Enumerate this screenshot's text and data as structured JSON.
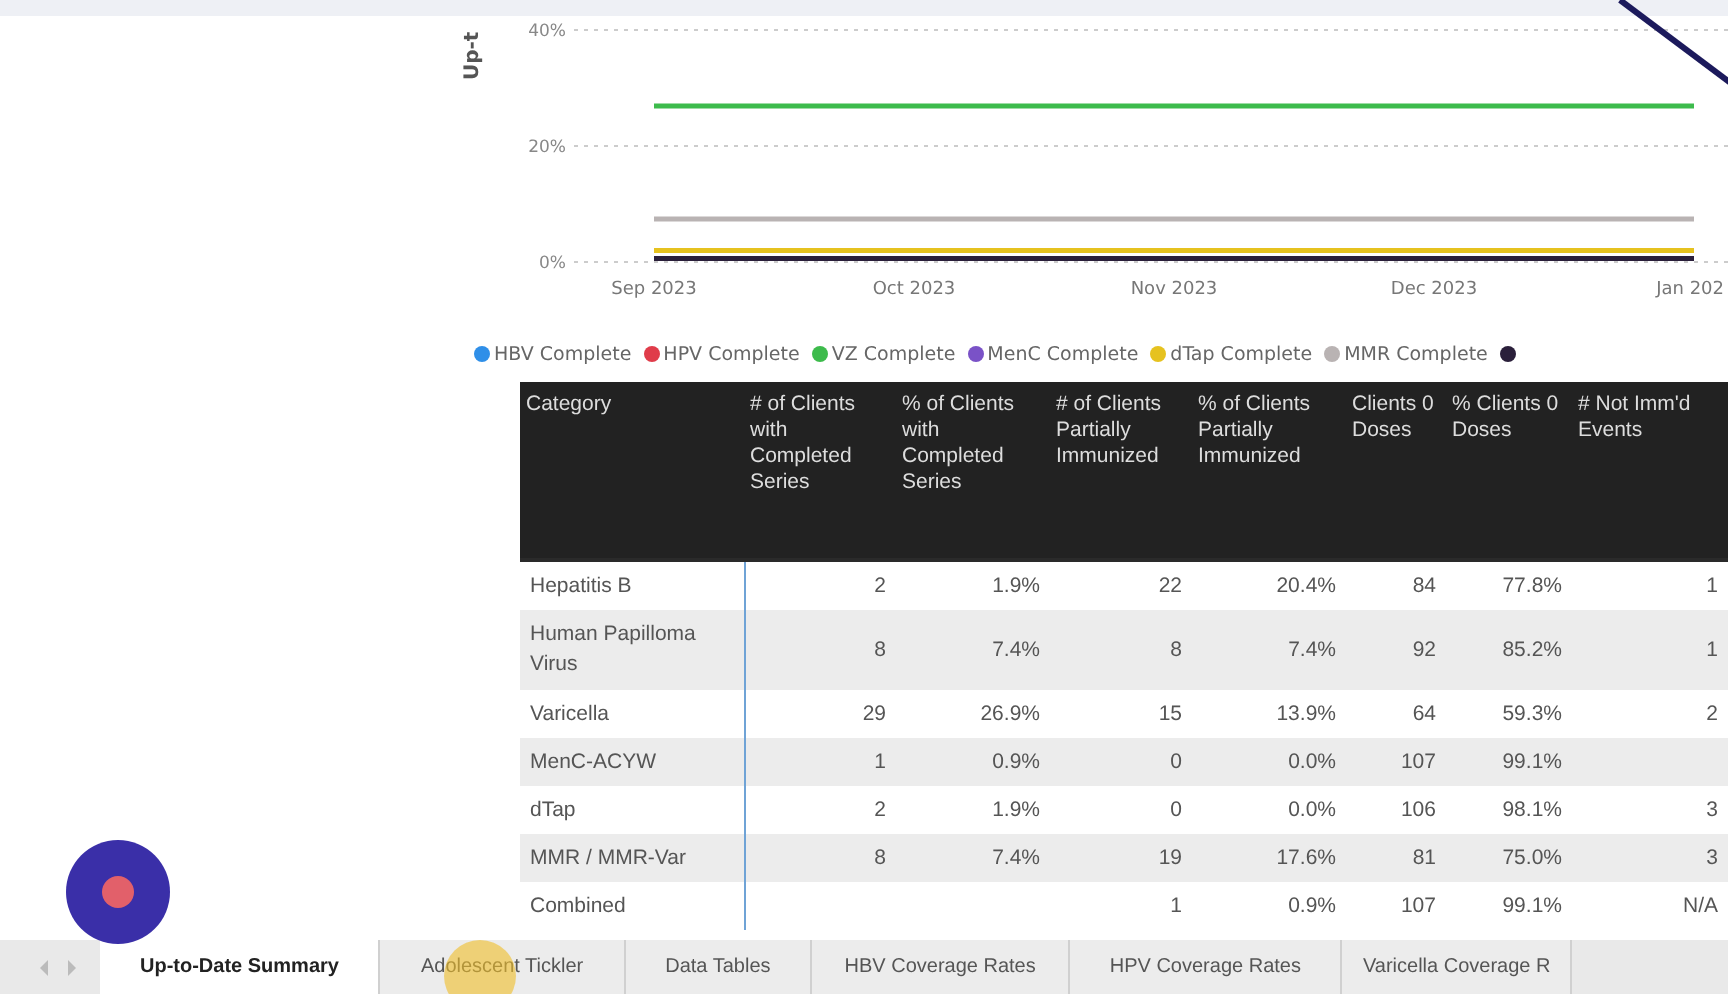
{
  "chart": {
    "chart_data": {
      "type": "line",
      "ylabel": "Up-t",
      "x": [
        "Sep 2023",
        "Oct 2023",
        "Nov 2023",
        "Dec 2023",
        "Jan 202"
      ],
      "ylim": [
        0,
        40
      ],
      "yticks": [
        {
          "value": 0,
          "label": "0%"
        },
        {
          "value": 20,
          "label": "20%"
        },
        {
          "value": 40,
          "label": "40%"
        }
      ],
      "series": [
        {
          "name": "HBV Complete",
          "color": "#2f8fe8",
          "values": [
            null,
            null,
            null,
            null,
            null
          ]
        },
        {
          "name": "HPV Complete",
          "color": "#e03c4a",
          "values": [
            null,
            null,
            null,
            null,
            null
          ]
        },
        {
          "name": "VZ Complete",
          "color": "#3dbb4c",
          "values": [
            26.9,
            26.9,
            26.9,
            26.9,
            26.9
          ]
        },
        {
          "name": "MenC Complete",
          "color": "#7a52c7",
          "values": [
            null,
            null,
            null,
            null,
            null
          ]
        },
        {
          "name": "dTap Complete",
          "color": "#e6c21f",
          "values": [
            2,
            2,
            2,
            2,
            2
          ]
        },
        {
          "name": "MMR Complete",
          "color": "#b9b3b3",
          "values": [
            7.4,
            7.4,
            7.4,
            7.4,
            7.4
          ]
        },
        {
          "color": "#2a1f3a",
          "values": [
            0.6,
            0.6,
            0.6,
            0.6,
            0.6
          ]
        }
      ]
    }
  },
  "table": {
    "columns": [
      "Category",
      "# of Clients with Completed Series",
      "% of Clients with Completed Series",
      "# of Clients Partially Immunized",
      "% of Clients Partially Immunized",
      "Clients 0 Doses",
      "% Clients 0 Doses",
      "# Not Imm'd Events"
    ],
    "rows": [
      {
        "cells": [
          "Hepatitis B",
          "2",
          "1.9%",
          "22",
          "20.4%",
          "84",
          "77.8%",
          "1"
        ]
      },
      {
        "cells": [
          "Human Papilloma Virus",
          "8",
          "7.4%",
          "8",
          "7.4%",
          "92",
          "85.2%",
          "1"
        ]
      },
      {
        "cells": [
          "Varicella",
          "29",
          "26.9%",
          "15",
          "13.9%",
          "64",
          "59.3%",
          "2"
        ]
      },
      {
        "cells": [
          "MenC-ACYW",
          "1",
          "0.9%",
          "0",
          "0.0%",
          "107",
          "99.1%",
          null
        ]
      },
      {
        "cells": [
          "dTap",
          "2",
          "1.9%",
          "0",
          "0.0%",
          "106",
          "98.1%",
          "3"
        ]
      },
      {
        "cells": [
          "MMR / MMR-Var",
          "8",
          "7.4%",
          "19",
          "17.6%",
          "81",
          "75.0%",
          "3"
        ]
      },
      {
        "cells": [
          "Combined",
          null,
          null,
          "1",
          "0.9%",
          "107",
          "99.1%",
          "N/A"
        ]
      }
    ]
  },
  "tabs": [
    {
      "label": "Up-to-Date Summary",
      "selected": true
    },
    {
      "label": "Adolescent Tickler",
      "selected": false
    },
    {
      "label": "Data Tables",
      "selected": false
    },
    {
      "label": "HBV Coverage Rates",
      "selected": false
    },
    {
      "label": "HPV Coverage Rates",
      "selected": false
    },
    {
      "label": "Varicella Coverage R",
      "selected": false
    }
  ]
}
